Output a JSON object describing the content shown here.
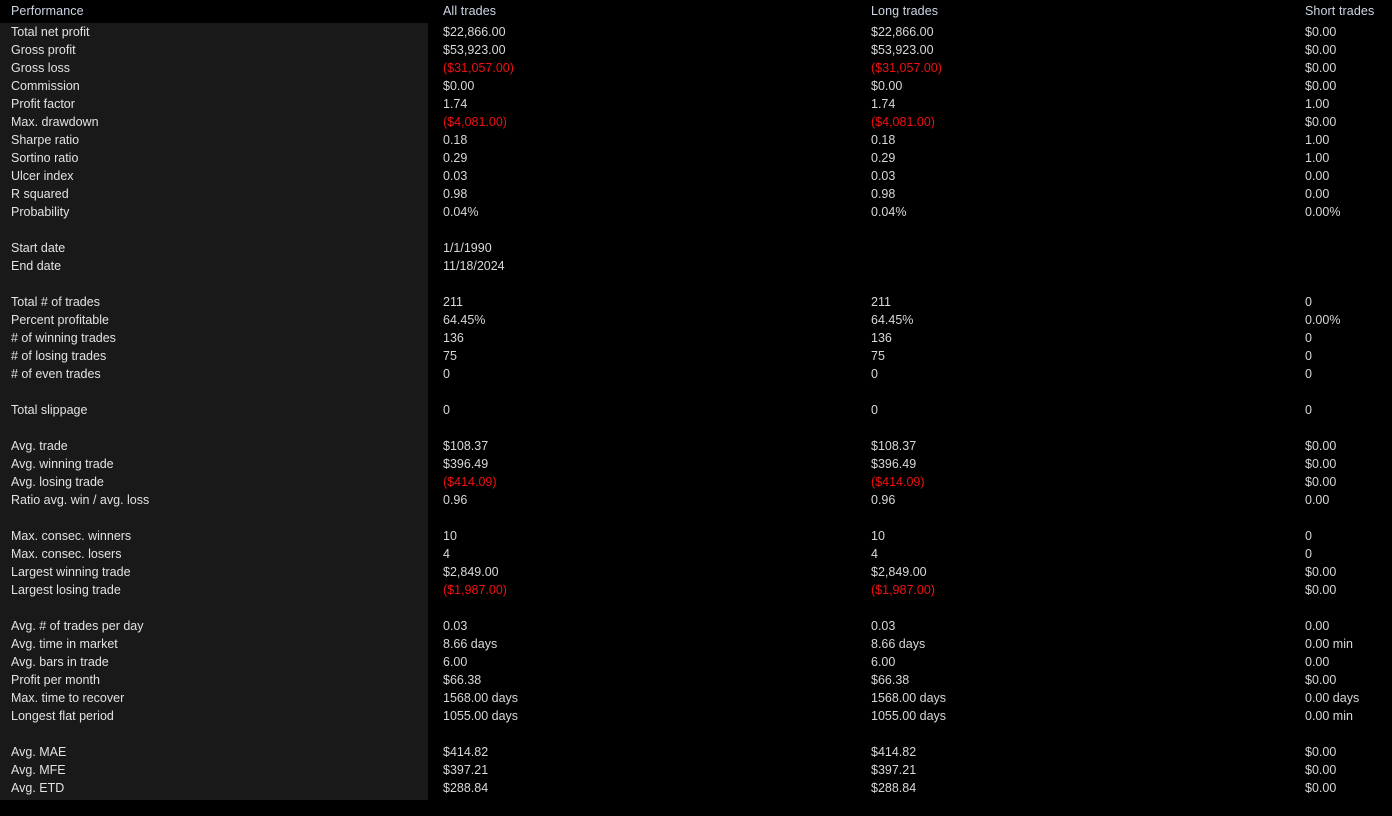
{
  "header": {
    "columns": [
      {
        "key": "label",
        "label": "Performance"
      },
      {
        "key": "all",
        "label": "All trades"
      },
      {
        "key": "long",
        "label": "Long trades"
      },
      {
        "key": "short",
        "label": "Short trades"
      }
    ]
  },
  "colors": {
    "background": "#000000",
    "label_panel": "#191919",
    "header_text": "#ccd6e4",
    "value_text": "#d8d8d8",
    "label_text": "#e2e2e2",
    "negative": "#ee1111"
  },
  "rows": [
    {
      "label": "Total net profit",
      "all": "$22,866.00",
      "long": "$22,866.00",
      "short": "$0.00"
    },
    {
      "label": "Gross profit",
      "all": "$53,923.00",
      "long": "$53,923.00",
      "short": "$0.00"
    },
    {
      "label": "Gross loss",
      "all": "($31,057.00)",
      "long": "($31,057.00)",
      "short": "$0.00",
      "neg": [
        "all",
        "long"
      ]
    },
    {
      "label": "Commission",
      "all": "$0.00",
      "long": "$0.00",
      "short": "$0.00"
    },
    {
      "label": "Profit factor",
      "all": "1.74",
      "long": "1.74",
      "short": "1.00"
    },
    {
      "label": "Max. drawdown",
      "all": "($4,081.00)",
      "long": "($4,081.00)",
      "short": "$0.00",
      "neg": [
        "all",
        "long"
      ]
    },
    {
      "label": "Sharpe ratio",
      "all": "0.18",
      "long": "0.18",
      "short": "1.00"
    },
    {
      "label": "Sortino ratio",
      "all": "0.29",
      "long": "0.29",
      "short": "1.00"
    },
    {
      "label": "Ulcer index",
      "all": "0.03",
      "long": "0.03",
      "short": "0.00"
    },
    {
      "label": "R squared",
      "all": "0.98",
      "long": "0.98",
      "short": "0.00"
    },
    {
      "label": "Probability",
      "all": "0.04%",
      "long": "0.04%",
      "short": "0.00%"
    },
    {
      "spacer": true
    },
    {
      "label": "Start date",
      "all": "1/1/1990",
      "long": "",
      "short": ""
    },
    {
      "label": "End date",
      "all": "11/18/2024",
      "long": "",
      "short": ""
    },
    {
      "spacer": true
    },
    {
      "label": "Total # of trades",
      "all": "211",
      "long": "211",
      "short": "0"
    },
    {
      "label": "Percent profitable",
      "all": "64.45%",
      "long": "64.45%",
      "short": "0.00%"
    },
    {
      "label": "# of winning trades",
      "all": "136",
      "long": "136",
      "short": "0"
    },
    {
      "label": "# of losing trades",
      "all": "75",
      "long": "75",
      "short": "0"
    },
    {
      "label": "# of even trades",
      "all": "0",
      "long": "0",
      "short": "0"
    },
    {
      "spacer": true
    },
    {
      "label": "Total slippage",
      "all": "0",
      "long": "0",
      "short": "0"
    },
    {
      "spacer": true
    },
    {
      "label": "Avg. trade",
      "all": "$108.37",
      "long": "$108.37",
      "short": "$0.00"
    },
    {
      "label": "Avg. winning trade",
      "all": "$396.49",
      "long": "$396.49",
      "short": "$0.00"
    },
    {
      "label": "Avg. losing trade",
      "all": "($414.09)",
      "long": "($414.09)",
      "short": "$0.00",
      "neg": [
        "all",
        "long"
      ]
    },
    {
      "label": "Ratio avg. win / avg. loss",
      "all": "0.96",
      "long": "0.96",
      "short": "0.00"
    },
    {
      "spacer": true
    },
    {
      "label": "Max. consec. winners",
      "all": "10",
      "long": "10",
      "short": "0"
    },
    {
      "label": "Max. consec. losers",
      "all": "4",
      "long": "4",
      "short": "0"
    },
    {
      "label": "Largest winning trade",
      "all": "$2,849.00",
      "long": "$2,849.00",
      "short": "$0.00"
    },
    {
      "label": "Largest losing trade",
      "all": "($1,987.00)",
      "long": "($1,987.00)",
      "short": "$0.00",
      "neg": [
        "all",
        "long"
      ]
    },
    {
      "spacer": true
    },
    {
      "label": "Avg. # of trades per day",
      "all": "0.03",
      "long": "0.03",
      "short": "0.00"
    },
    {
      "label": "Avg. time in market",
      "all": "8.66 days",
      "long": "8.66 days",
      "short": "0.00 min"
    },
    {
      "label": "Avg. bars in trade",
      "all": "6.00",
      "long": "6.00",
      "short": "0.00"
    },
    {
      "label": "Profit per month",
      "all": "$66.38",
      "long": "$66.38",
      "short": "$0.00"
    },
    {
      "label": "Max. time to recover",
      "all": "1568.00 days",
      "long": "1568.00 days",
      "short": "0.00 days"
    },
    {
      "label": "Longest flat period",
      "all": "1055.00 days",
      "long": "1055.00 days",
      "short": "0.00 min"
    },
    {
      "spacer": true
    },
    {
      "label": "Avg. MAE",
      "all": "$414.82",
      "long": "$414.82",
      "short": "$0.00"
    },
    {
      "label": "Avg. MFE",
      "all": "$397.21",
      "long": "$397.21",
      "short": "$0.00"
    },
    {
      "label": "Avg. ETD",
      "all": "$288.84",
      "long": "$288.84",
      "short": "$0.00"
    }
  ]
}
